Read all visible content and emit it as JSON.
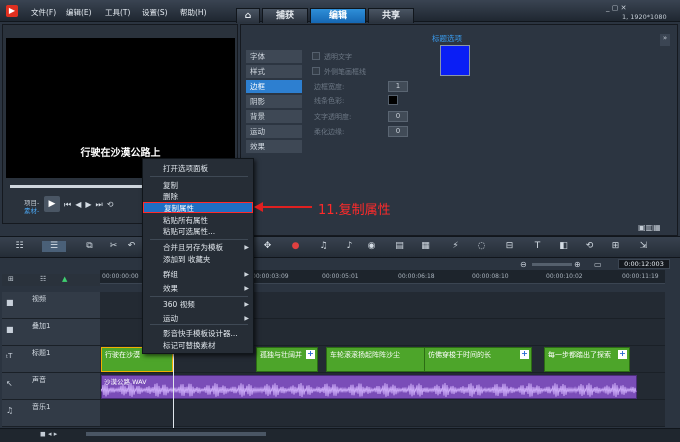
{
  "menu": {
    "file": "文件(F)",
    "edit": "编辑(E)",
    "tools": "工具(T)",
    "settings": "设置(S)",
    "help": "帮助(H)"
  },
  "tabs": {
    "capture": "捕获",
    "edit": "编辑",
    "share": "共享"
  },
  "resolution": "1, 1920*1080",
  "preview": {
    "subtitle": "行驶在沙漠公路上",
    "project_label": "项目-",
    "clip_label": "素材-"
  },
  "attributes": {
    "header": "标题选项",
    "tabs": [
      "字体",
      "样式",
      "边框",
      "阴影",
      "背景",
      "运动",
      "效果"
    ],
    "options": {
      "transparent_text": "透明文字",
      "outer_stroke": "外侧笔画框线",
      "border_width": "边框宽度:",
      "line_color": "线条色彩:",
      "text_opacity": "文字透明度:",
      "soft_edge": "柔化边缘:"
    },
    "spinner_values": [
      "1",
      "0",
      "0"
    ],
    "swatch_color": "#0a1ef5"
  },
  "context_menu": {
    "items": [
      {
        "label": "打开选项面板",
        "sub": false
      },
      {
        "label": "复制",
        "sub": false
      },
      {
        "label": "删除",
        "sub": false
      },
      {
        "label": "复制属性",
        "sub": false
      },
      {
        "label": "粘贴所有属性",
        "sub": false
      },
      {
        "label": "粘贴可选属性...",
        "sub": false
      },
      {
        "label": "合并且另存为模板",
        "sub": true
      },
      {
        "label": "添加到 收藏夹",
        "sub": false
      },
      {
        "label": "群组",
        "sub": true
      },
      {
        "label": "效果",
        "sub": true
      },
      {
        "label": "360 视频",
        "sub": true
      },
      {
        "label": "运动",
        "sub": true
      },
      {
        "label": "影音快手模板设计器...",
        "sub": false
      },
      {
        "label": "标记可替换素材",
        "sub": false
      }
    ]
  },
  "annotation": "11.复制属性",
  "timecode": "0:00:12:003",
  "ruler": [
    "00:00:00:00",
    "00:00:03:09",
    "00:00:05:01",
    "00:00:06:18",
    "00:00:08:10",
    "00:00:10:02",
    "00:00:11:19"
  ],
  "tracks": [
    "视频",
    "叠加1",
    "标题1",
    "声音",
    "音乐1"
  ],
  "title_clips": [
    "行驶在沙漠",
    "孤独与壮阔并",
    "车轮滚滚扬起阵阵沙尘",
    "仿佛穿梭于时间的长",
    "每一步都踏出了探索"
  ],
  "audio_clip": "沙漠公路.WAV"
}
